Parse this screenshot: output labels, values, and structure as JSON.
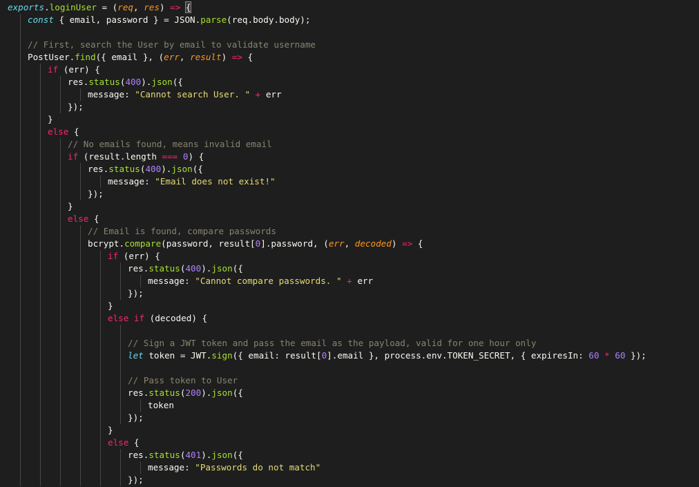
{
  "editor": {
    "lines": [
      {
        "depth": 0,
        "tokens": [
          [
            "store",
            "exports"
          ],
          [
            "plain",
            "."
          ],
          [
            "fn",
            "loginUser"
          ],
          [
            "plain",
            " = ("
          ],
          [
            "param",
            "req"
          ],
          [
            "plain",
            ", "
          ],
          [
            "param",
            "res"
          ],
          [
            "plain",
            ") "
          ],
          [
            "op",
            "=>"
          ],
          [
            "plain",
            " "
          ],
          [
            "bracket",
            "{"
          ]
        ]
      },
      {
        "depth": 1,
        "tokens": [
          [
            "store",
            "const"
          ],
          [
            "plain",
            " { email, password } = JSON."
          ],
          [
            "fn",
            "parse"
          ],
          [
            "plain",
            "(req.body.body);"
          ]
        ]
      },
      {
        "depth": 1,
        "tokens": []
      },
      {
        "depth": 1,
        "tokens": [
          [
            "cmt",
            "// First, search the User by email to validate username"
          ]
        ]
      },
      {
        "depth": 1,
        "tokens": [
          [
            "plain",
            "PostUser."
          ],
          [
            "fn",
            "find"
          ],
          [
            "plain",
            "({ email }, ("
          ],
          [
            "param",
            "err"
          ],
          [
            "plain",
            ", "
          ],
          [
            "param",
            "result"
          ],
          [
            "plain",
            ") "
          ],
          [
            "op",
            "=>"
          ],
          [
            "plain",
            " {"
          ]
        ]
      },
      {
        "depth": 2,
        "tokens": [
          [
            "kw",
            "if"
          ],
          [
            "plain",
            " (err) {"
          ]
        ]
      },
      {
        "depth": 3,
        "tokens": [
          [
            "plain",
            "res."
          ],
          [
            "fn",
            "status"
          ],
          [
            "plain",
            "("
          ],
          [
            "num",
            "400"
          ],
          [
            "plain",
            ")."
          ],
          [
            "fn",
            "json"
          ],
          [
            "plain",
            "({"
          ]
        ]
      },
      {
        "depth": 4,
        "tokens": [
          [
            "plain",
            "message: "
          ],
          [
            "str",
            "\"Cannot search User. \""
          ],
          [
            "plain",
            " "
          ],
          [
            "op",
            "+"
          ],
          [
            "plain",
            " err"
          ]
        ]
      },
      {
        "depth": 3,
        "tokens": [
          [
            "plain",
            "});"
          ]
        ]
      },
      {
        "depth": 2,
        "tokens": [
          [
            "plain",
            "}"
          ]
        ]
      },
      {
        "depth": 2,
        "tokens": [
          [
            "kw",
            "else"
          ],
          [
            "plain",
            " {"
          ]
        ]
      },
      {
        "depth": 3,
        "tokens": [
          [
            "cmt",
            "// No emails found, means invalid email"
          ]
        ]
      },
      {
        "depth": 3,
        "tokens": [
          [
            "kw",
            "if"
          ],
          [
            "plain",
            " (result.length "
          ],
          [
            "op",
            "==="
          ],
          [
            "plain",
            " "
          ],
          [
            "num",
            "0"
          ],
          [
            "plain",
            ") {"
          ]
        ]
      },
      {
        "depth": 4,
        "tokens": [
          [
            "plain",
            "res."
          ],
          [
            "fn",
            "status"
          ],
          [
            "plain",
            "("
          ],
          [
            "num",
            "400"
          ],
          [
            "plain",
            ")."
          ],
          [
            "fn",
            "json"
          ],
          [
            "plain",
            "({"
          ]
        ]
      },
      {
        "depth": 5,
        "tokens": [
          [
            "plain",
            "message: "
          ],
          [
            "str",
            "\"Email does not exist!\""
          ]
        ]
      },
      {
        "depth": 4,
        "tokens": [
          [
            "plain",
            "});"
          ]
        ]
      },
      {
        "depth": 3,
        "tokens": [
          [
            "plain",
            "}"
          ]
        ]
      },
      {
        "depth": 3,
        "tokens": [
          [
            "kw",
            "else"
          ],
          [
            "plain",
            " {"
          ]
        ]
      },
      {
        "depth": 4,
        "tokens": [
          [
            "cmt",
            "// Email is found, compare passwords"
          ]
        ]
      },
      {
        "depth": 4,
        "tokens": [
          [
            "plain",
            "bcrypt."
          ],
          [
            "fn",
            "compare"
          ],
          [
            "plain",
            "(password, result["
          ],
          [
            "num",
            "0"
          ],
          [
            "plain",
            "].password, ("
          ],
          [
            "param",
            "err"
          ],
          [
            "plain",
            ", "
          ],
          [
            "param",
            "decoded"
          ],
          [
            "plain",
            ") "
          ],
          [
            "op",
            "=>"
          ],
          [
            "plain",
            " {"
          ]
        ]
      },
      {
        "depth": 5,
        "tokens": [
          [
            "kw",
            "if"
          ],
          [
            "plain",
            " (err) {"
          ]
        ]
      },
      {
        "depth": 6,
        "tokens": [
          [
            "plain",
            "res."
          ],
          [
            "fn",
            "status"
          ],
          [
            "plain",
            "("
          ],
          [
            "num",
            "400"
          ],
          [
            "plain",
            ")."
          ],
          [
            "fn",
            "json"
          ],
          [
            "plain",
            "({"
          ]
        ]
      },
      {
        "depth": 7,
        "tokens": [
          [
            "plain",
            "message: "
          ],
          [
            "str",
            "\"Cannot compare passwords. \""
          ],
          [
            "plain",
            " "
          ],
          [
            "op",
            "+"
          ],
          [
            "plain",
            " err"
          ]
        ]
      },
      {
        "depth": 6,
        "tokens": [
          [
            "plain",
            "});"
          ]
        ]
      },
      {
        "depth": 5,
        "tokens": [
          [
            "plain",
            "}"
          ]
        ]
      },
      {
        "depth": 5,
        "tokens": [
          [
            "kw",
            "else if"
          ],
          [
            "plain",
            " (decoded) {"
          ]
        ]
      },
      {
        "depth": 6,
        "tokens": []
      },
      {
        "depth": 6,
        "tokens": [
          [
            "cmt",
            "// Sign a JWT token and pass the email as the payload, valid for one hour only"
          ]
        ]
      },
      {
        "depth": 6,
        "tokens": [
          [
            "store",
            "let"
          ],
          [
            "plain",
            " token = JWT."
          ],
          [
            "fn",
            "sign"
          ],
          [
            "plain",
            "({ email: result["
          ],
          [
            "num",
            "0"
          ],
          [
            "plain",
            "].email }, process.env.TOKEN_SECRET, { expiresIn: "
          ],
          [
            "num",
            "60"
          ],
          [
            "plain",
            " "
          ],
          [
            "op",
            "*"
          ],
          [
            "plain",
            " "
          ],
          [
            "num",
            "60"
          ],
          [
            "plain",
            " });"
          ]
        ]
      },
      {
        "depth": 6,
        "tokens": []
      },
      {
        "depth": 6,
        "tokens": [
          [
            "cmt",
            "// Pass token to User"
          ]
        ]
      },
      {
        "depth": 6,
        "tokens": [
          [
            "plain",
            "res."
          ],
          [
            "fn",
            "status"
          ],
          [
            "plain",
            "("
          ],
          [
            "num",
            "200"
          ],
          [
            "plain",
            ")."
          ],
          [
            "fn",
            "json"
          ],
          [
            "plain",
            "({"
          ]
        ]
      },
      {
        "depth": 7,
        "tokens": [
          [
            "plain",
            "token"
          ]
        ]
      },
      {
        "depth": 6,
        "tokens": [
          [
            "plain",
            "});"
          ]
        ]
      },
      {
        "depth": 5,
        "tokens": [
          [
            "plain",
            "}"
          ]
        ]
      },
      {
        "depth": 5,
        "tokens": [
          [
            "kw",
            "else"
          ],
          [
            "plain",
            " {"
          ]
        ]
      },
      {
        "depth": 6,
        "tokens": [
          [
            "plain",
            "res."
          ],
          [
            "fn",
            "status"
          ],
          [
            "plain",
            "("
          ],
          [
            "num",
            "401"
          ],
          [
            "plain",
            ")."
          ],
          [
            "fn",
            "json"
          ],
          [
            "plain",
            "({"
          ]
        ]
      },
      {
        "depth": 7,
        "tokens": [
          [
            "plain",
            "message: "
          ],
          [
            "str",
            "\"Passwords do not match\""
          ]
        ]
      },
      {
        "depth": 6,
        "tokens": [
          [
            "plain",
            "});"
          ]
        ]
      }
    ]
  },
  "theme": {
    "background": "#1e1e1e",
    "keyword": "#f92672",
    "storage": "#66d9ef",
    "function": "#a6e22e",
    "parameter": "#fd971f",
    "string": "#e6db74",
    "number": "#ae81ff",
    "comment": "#88846f",
    "text": "#f8f8f2"
  }
}
